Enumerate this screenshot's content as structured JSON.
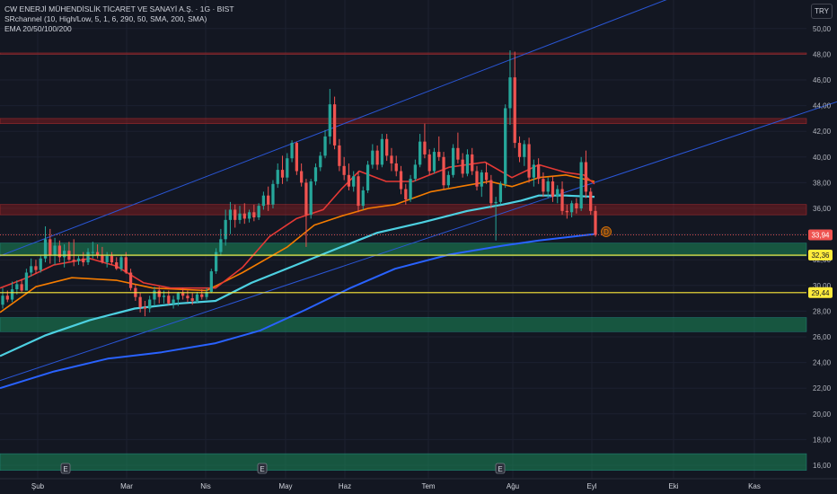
{
  "legend": {
    "title": "CW ENERJİ MÜHENDİSLİK TİCARET VE SANAYİ A.Ş. · 1G · BIST",
    "indicator1": "SRchannel (10, High/Low, 5, 1, 6, 290, 50, SMA, 200, SMA)",
    "indicator2": "EMA 20/50/100/200"
  },
  "currency_label": "TRY",
  "colors": {
    "background": "#131722",
    "up_candle": "#26a69a",
    "down_candle": "#ef5350",
    "ema20": "#e53935",
    "ema50": "#f57c00",
    "ema100": "#4dd0e1",
    "ema200": "#2962ff",
    "trendline": "#2a56d6",
    "resistance_zone": "#b71c1c",
    "support_zone": "#1b8a5a",
    "level_line": "#ffeb3b"
  },
  "chart_data": {
    "type": "candlestick",
    "y_axis": {
      "ticks": [
        "16,00",
        "18,00",
        "20,00",
        "22,00",
        "24,00",
        "26,00",
        "28,00",
        "30,00",
        "32,00",
        "34,00",
        "36,00",
        "38,00",
        "40,00",
        "42,00",
        "44,00",
        "46,00",
        "48,00",
        "50,00"
      ],
      "range": [
        15.5,
        51.2
      ]
    },
    "x_axis": {
      "ticks": [
        "Şub",
        "Mar",
        "Nis",
        "May",
        "Haz",
        "Tem",
        "Ağu",
        "Eyl",
        "Eki",
        "Kas"
      ]
    },
    "price_tags": [
      {
        "label": "33,94",
        "value": 33.94,
        "bg": "#ef5350",
        "color": "#ffffff"
      },
      {
        "label": "32,36",
        "value": 32.36,
        "bg": "#ffeb3b",
        "color": "#131722"
      },
      {
        "label": "29,44",
        "value": 29.44,
        "bg": "#ffeb3b",
        "color": "#131722"
      }
    ],
    "zones": [
      {
        "kind": "resistance",
        "from": 48.0,
        "to": 48.1
      },
      {
        "kind": "resistance",
        "from": 42.6,
        "to": 43.0
      },
      {
        "kind": "resistance",
        "from": 35.5,
        "to": 36.3
      },
      {
        "kind": "support",
        "from": 32.3,
        "to": 33.3
      },
      {
        "kind": "support",
        "from": 26.4,
        "to": 27.5
      },
      {
        "kind": "support",
        "from": 15.6,
        "to": 16.9
      }
    ],
    "horizontal_levels": [
      32.36,
      29.44
    ],
    "earnings_markers": [
      "E",
      "E",
      "E"
    ],
    "dividend_marker": "D",
    "ema20": [
      [
        0,
        29.8
      ],
      [
        30,
        30.6
      ],
      [
        60,
        31.6
      ],
      [
        100,
        32.1
      ],
      [
        130,
        31.5
      ],
      [
        160,
        30.2
      ],
      [
        190,
        29.8
      ],
      [
        240,
        29.8
      ],
      [
        270,
        31.4
      ],
      [
        300,
        33.8
      ],
      [
        330,
        35.2
      ],
      [
        360,
        35.9
      ],
      [
        380,
        37.5
      ],
      [
        400,
        38.9
      ],
      [
        430,
        38.1
      ],
      [
        460,
        38.1
      ],
      [
        500,
        39.2
      ],
      [
        540,
        39.6
      ],
      [
        570,
        38.4
      ],
      [
        600,
        39.4
      ],
      [
        630,
        38.8
      ],
      [
        650,
        38.6
      ],
      [
        662,
        37.9
      ]
    ],
    "ema50": [
      [
        0,
        27.9
      ],
      [
        40,
        29.9
      ],
      [
        80,
        30.6
      ],
      [
        130,
        30.4
      ],
      [
        170,
        29.8
      ],
      [
        230,
        29.6
      ],
      [
        270,
        31.0
      ],
      [
        320,
        33.0
      ],
      [
        350,
        34.7
      ],
      [
        380,
        35.4
      ],
      [
        410,
        36.0
      ],
      [
        440,
        36.3
      ],
      [
        480,
        37.3
      ],
      [
        520,
        37.8
      ],
      [
        545,
        38.1
      ],
      [
        570,
        37.7
      ],
      [
        600,
        38.4
      ],
      [
        630,
        38.6
      ],
      [
        662,
        38.1
      ]
    ],
    "ema100": [
      [
        0,
        24.5
      ],
      [
        50,
        26.1
      ],
      [
        100,
        27.3
      ],
      [
        150,
        28.2
      ],
      [
        200,
        28.6
      ],
      [
        240,
        28.8
      ],
      [
        280,
        30.2
      ],
      [
        330,
        31.6
      ],
      [
        380,
        33.0
      ],
      [
        420,
        34.1
      ],
      [
        470,
        34.9
      ],
      [
        520,
        35.8
      ],
      [
        560,
        36.3
      ],
      [
        580,
        36.6
      ],
      [
        600,
        37.0
      ],
      [
        630,
        37.0
      ],
      [
        662,
        36.9
      ]
    ],
    "ema200": [
      [
        0,
        22.0
      ],
      [
        60,
        23.3
      ],
      [
        120,
        24.3
      ],
      [
        180,
        24.8
      ],
      [
        240,
        25.5
      ],
      [
        290,
        26.5
      ],
      [
        340,
        28.1
      ],
      [
        390,
        29.8
      ],
      [
        440,
        31.3
      ],
      [
        500,
        32.4
      ],
      [
        560,
        33.1
      ],
      [
        600,
        33.5
      ],
      [
        662,
        34.0
      ]
    ],
    "channel_upper": [
      [
        0,
        32.3
      ],
      [
        770,
        53.0
      ]
    ],
    "channel_lower": [
      [
        0,
        22.6
      ],
      [
        932,
        44.3
      ]
    ],
    "candles": [
      [
        28.5,
        29.8,
        28.2,
        29.2
      ],
      [
        29.2,
        29.6,
        28.7,
        28.9
      ],
      [
        28.9,
        30.3,
        28.7,
        29.7
      ],
      [
        29.7,
        30.4,
        29.3,
        30.1
      ],
      [
        30.1,
        30.5,
        29.5,
        29.6
      ],
      [
        29.6,
        31.3,
        29.6,
        31.0
      ],
      [
        31.0,
        32.1,
        30.7,
        31.5
      ],
      [
        31.5,
        32.0,
        30.9,
        31.2
      ],
      [
        31.2,
        32.4,
        31.0,
        32.1
      ],
      [
        32.1,
        34.6,
        31.8,
        33.6
      ],
      [
        33.6,
        34.4,
        31.7,
        32.4
      ],
      [
        32.4,
        33.7,
        31.6,
        33.1
      ],
      [
        33.1,
        33.5,
        31.8,
        32.2
      ],
      [
        32.2,
        33.2,
        31.4,
        32.7
      ],
      [
        32.7,
        33.4,
        31.9,
        32.0
      ],
      [
        32.0,
        33.6,
        31.5,
        31.9
      ],
      [
        31.9,
        32.3,
        31.6,
        32.1
      ],
      [
        32.1,
        32.6,
        31.5,
        31.8
      ],
      [
        31.8,
        32.9,
        31.6,
        32.6
      ],
      [
        32.6,
        33.4,
        32.1,
        32.6
      ],
      [
        32.6,
        33.2,
        32.1,
        32.4
      ],
      [
        32.4,
        33.0,
        31.7,
        31.8
      ],
      [
        31.8,
        32.6,
        31.4,
        32.3
      ],
      [
        32.3,
        32.6,
        31.6,
        31.8
      ],
      [
        31.8,
        32.2,
        31.2,
        31.3
      ],
      [
        31.3,
        32.4,
        31.1,
        32.2
      ],
      [
        32.2,
        32.6,
        30.9,
        31.0
      ],
      [
        31.0,
        31.3,
        29.6,
        29.8
      ],
      [
        29.8,
        30.1,
        28.8,
        29.1
      ],
      [
        29.1,
        29.4,
        27.9,
        28.3
      ],
      [
        28.3,
        28.8,
        27.6,
        28.2
      ],
      [
        28.2,
        29.2,
        27.9,
        28.9
      ],
      [
        28.9,
        29.9,
        28.4,
        29.6
      ],
      [
        29.6,
        29.9,
        28.6,
        29.1
      ],
      [
        29.1,
        29.6,
        28.6,
        29.2
      ],
      [
        29.2,
        29.6,
        28.5,
        28.6
      ],
      [
        28.6,
        29.2,
        28.2,
        28.9
      ],
      [
        28.9,
        29.5,
        28.4,
        29.4
      ],
      [
        29.4,
        29.8,
        28.9,
        29.2
      ],
      [
        29.2,
        29.6,
        28.7,
        29.0
      ],
      [
        29.0,
        29.4,
        28.5,
        28.8
      ],
      [
        28.8,
        29.5,
        28.6,
        29.3
      ],
      [
        29.3,
        29.7,
        28.9,
        29.1
      ],
      [
        29.1,
        29.8,
        28.9,
        29.5
      ],
      [
        29.5,
        31.3,
        29.4,
        31.1
      ],
      [
        31.1,
        32.9,
        30.9,
        32.6
      ],
      [
        32.6,
        34.4,
        32.3,
        33.6
      ],
      [
        33.6,
        35.9,
        33.1,
        35.1
      ],
      [
        35.1,
        36.5,
        34.0,
        35.9
      ],
      [
        35.9,
        36.3,
        34.5,
        35.1
      ],
      [
        35.1,
        36.2,
        34.8,
        35.6
      ],
      [
        35.6,
        36.4,
        34.8,
        35.2
      ],
      [
        35.2,
        35.9,
        34.9,
        35.7
      ],
      [
        35.7,
        36.3,
        35.0,
        35.3
      ],
      [
        35.3,
        36.4,
        35.1,
        36.2
      ],
      [
        36.2,
        37.3,
        35.9,
        37.0
      ],
      [
        37.0,
        37.7,
        35.8,
        36.3
      ],
      [
        36.3,
        38.2,
        36.0,
        37.9
      ],
      [
        37.9,
        39.5,
        37.6,
        39.0
      ],
      [
        39.0,
        40.1,
        37.9,
        38.4
      ],
      [
        38.4,
        40.3,
        38.1,
        39.9
      ],
      [
        39.9,
        41.3,
        39.6,
        41.1
      ],
      [
        41.1,
        41.2,
        38.6,
        38.9
      ],
      [
        38.9,
        39.5,
        37.7,
        38.0
      ],
      [
        38.0,
        38.3,
        33.0,
        35.5
      ],
      [
        35.5,
        38.3,
        35.2,
        38.1
      ],
      [
        38.1,
        39.5,
        37.8,
        39.2
      ],
      [
        39.2,
        40.4,
        38.9,
        40.1
      ],
      [
        40.1,
        42.1,
        39.9,
        41.6
      ],
      [
        41.6,
        45.3,
        41.0,
        44.1
      ],
      [
        44.1,
        44.7,
        40.6,
        40.9
      ],
      [
        40.9,
        41.4,
        38.9,
        39.3
      ],
      [
        39.3,
        40.0,
        38.2,
        38.6
      ],
      [
        38.6,
        39.5,
        37.4,
        37.7
      ],
      [
        37.7,
        38.9,
        37.3,
        38.5
      ],
      [
        38.5,
        38.9,
        35.7,
        36.2
      ],
      [
        36.2,
        37.7,
        35.9,
        37.4
      ],
      [
        37.4,
        39.7,
        37.2,
        39.4
      ],
      [
        39.4,
        41.0,
        39.1,
        40.5
      ],
      [
        40.5,
        40.9,
        39.0,
        39.4
      ],
      [
        39.4,
        41.8,
        39.2,
        41.4
      ],
      [
        41.4,
        41.8,
        39.7,
        40.1
      ],
      [
        40.1,
        40.7,
        38.9,
        39.5
      ],
      [
        39.5,
        40.1,
        38.5,
        38.9
      ],
      [
        38.9,
        39.3,
        37.1,
        37.5
      ],
      [
        37.5,
        37.9,
        36.3,
        36.7
      ],
      [
        36.7,
        38.6,
        36.5,
        38.3
      ],
      [
        38.3,
        39.8,
        38.1,
        39.4
      ],
      [
        39.4,
        41.8,
        39.2,
        41.2
      ],
      [
        41.2,
        42.6,
        39.9,
        40.2
      ],
      [
        40.2,
        40.6,
        38.6,
        38.9
      ],
      [
        38.9,
        40.7,
        38.7,
        40.4
      ],
      [
        40.4,
        41.6,
        39.7,
        40.0
      ],
      [
        40.0,
        40.4,
        37.5,
        37.8
      ],
      [
        37.8,
        38.9,
        37.6,
        38.6
      ],
      [
        38.6,
        41.0,
        38.4,
        40.7
      ],
      [
        40.7,
        41.9,
        39.5,
        39.8
      ],
      [
        39.8,
        40.3,
        38.4,
        38.7
      ],
      [
        38.7,
        40.6,
        38.5,
        40.2
      ],
      [
        40.2,
        40.7,
        38.6,
        38.9
      ],
      [
        38.9,
        39.3,
        37.4,
        37.7
      ],
      [
        37.7,
        39.0,
        36.9,
        38.8
      ],
      [
        38.8,
        39.6,
        37.9,
        38.2
      ],
      [
        38.2,
        38.6,
        36.0,
        36.4
      ],
      [
        36.4,
        36.9,
        33.5,
        36.5
      ],
      [
        36.5,
        38.1,
        36.3,
        37.9
      ],
      [
        37.9,
        44.1,
        37.6,
        43.8
      ],
      [
        43.8,
        48.3,
        42.5,
        46.2
      ],
      [
        46.2,
        48.2,
        40.7,
        41.1
      ],
      [
        41.1,
        41.6,
        39.6,
        40.0
      ],
      [
        40.0,
        41.3,
        39.3,
        41.0
      ],
      [
        41.0,
        41.5,
        38.0,
        38.4
      ],
      [
        38.4,
        39.8,
        37.7,
        39.4
      ],
      [
        39.4,
        39.9,
        37.9,
        38.3
      ],
      [
        38.3,
        38.8,
        36.9,
        37.3
      ],
      [
        37.3,
        38.4,
        36.8,
        38.1
      ],
      [
        38.1,
        38.5,
        36.5,
        36.9
      ],
      [
        36.9,
        37.8,
        36.4,
        37.5
      ],
      [
        37.5,
        38.1,
        35.5,
        35.8
      ],
      [
        35.8,
        36.3,
        35.2,
        35.7
      ],
      [
        35.7,
        36.6,
        35.3,
        36.4
      ],
      [
        36.4,
        36.8,
        35.6,
        36.0
      ],
      [
        36.0,
        40.0,
        35.8,
        39.6
      ],
      [
        39.6,
        40.5,
        36.8,
        37.3
      ],
      [
        37.3,
        37.6,
        35.5,
        35.8
      ],
      [
        35.8,
        36.2,
        33.8,
        33.94
      ]
    ]
  }
}
